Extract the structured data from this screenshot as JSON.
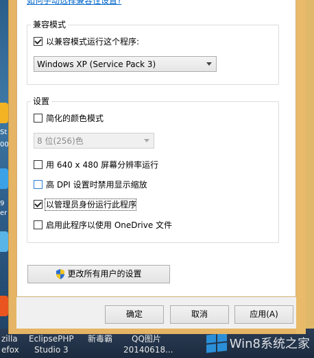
{
  "dialog": {
    "help_link": "如何手动选择兼容性设置?"
  },
  "compat_group": {
    "label": "兼容模式",
    "run_compat_checkbox": {
      "label": "以兼容模式运行这个程序:",
      "checked": true
    },
    "os_select": {
      "value": "Windows XP (Service Pack 3)"
    }
  },
  "settings_group": {
    "label": "设置",
    "reduced_color": {
      "label": "简化的颜色模式",
      "checked": false
    },
    "color_select": {
      "value": "8 位(256)色"
    },
    "res_640": {
      "label": "用 640 x 480 屏幕分辨率运行",
      "checked": false
    },
    "high_dpi": {
      "label": "高 DPI 设置时禁用显示缩放",
      "checked": false
    },
    "run_admin": {
      "label": "以管理员身份运行此程序",
      "checked": true
    },
    "onedrive": {
      "label": "启用此程序以使用 OneDrive 文件",
      "checked": false
    }
  },
  "change_all_users_button": "更改所有用户的设置",
  "footer": {
    "ok": "确定",
    "cancel": "取消",
    "apply": "应用(A)"
  },
  "desktop": {
    "left_fragments": [
      "St",
      "00",
      "9",
      "er"
    ],
    "bottom_items": [
      {
        "line1": "zilla",
        "line2": "efox"
      },
      {
        "line1": "EclipsePHP",
        "line2": "Studio 3"
      },
      {
        "line1": "新毒霸",
        "line2": ""
      },
      {
        "line1": "QQ图片",
        "line2": "20140618..."
      }
    ],
    "watermark": "Win8系统之家"
  }
}
